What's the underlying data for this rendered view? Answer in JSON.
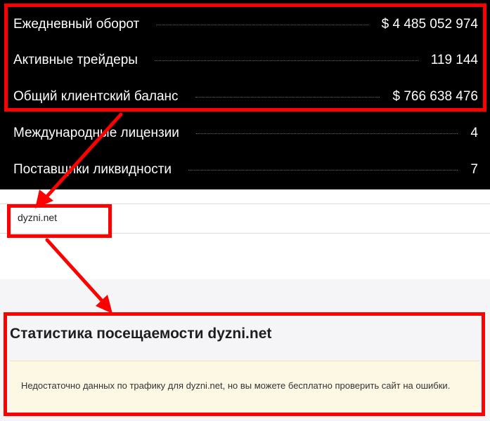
{
  "stats": [
    {
      "label": "Ежедневный оборот",
      "value": "$ 4 485 052 974"
    },
    {
      "label": "Активные трейдеры",
      "value": "119 144"
    },
    {
      "label": "Общий клиентский баланс",
      "value": "$ 766 638 476"
    },
    {
      "label": "Международные лицензии",
      "value": "4"
    },
    {
      "label": "Поставщики ликвидности",
      "value": "7"
    }
  ],
  "url_bar": {
    "domain": "dyzni.net"
  },
  "traffic": {
    "title": "Статистика посещаемости dyzni.net",
    "notice": "Недостаточно данных по трафику для dyzni.net, но вы можете бесплатно проверить сайт на ошибки."
  },
  "colors": {
    "highlight": "#ff0000",
    "panel_bg": "#000000",
    "notice_bg": "#fdf8e4"
  }
}
